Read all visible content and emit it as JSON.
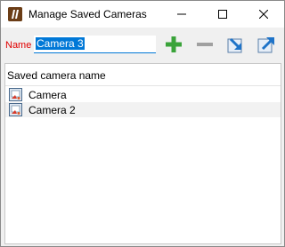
{
  "window": {
    "title": "Manage Saved Cameras",
    "app_icon": "app-logo-icon",
    "controls": [
      "minimize-icon",
      "maximize-icon",
      "close-icon"
    ]
  },
  "name_field": {
    "label": "Name",
    "value": "Camera 3"
  },
  "toolbar": {
    "add": "add-icon",
    "remove": "remove-icon",
    "import": "import-icon",
    "export": "export-icon"
  },
  "list": {
    "column_header": "Saved camera name",
    "items": [
      {
        "label": "Camera",
        "icon": "camera-icon"
      },
      {
        "label": "Camera 2",
        "icon": "camera-icon"
      }
    ]
  },
  "colors": {
    "accent": "#0078d7",
    "label_red": "#e00000",
    "add_green": "#3aa33a",
    "remove_gray": "#a0a0a0"
  }
}
